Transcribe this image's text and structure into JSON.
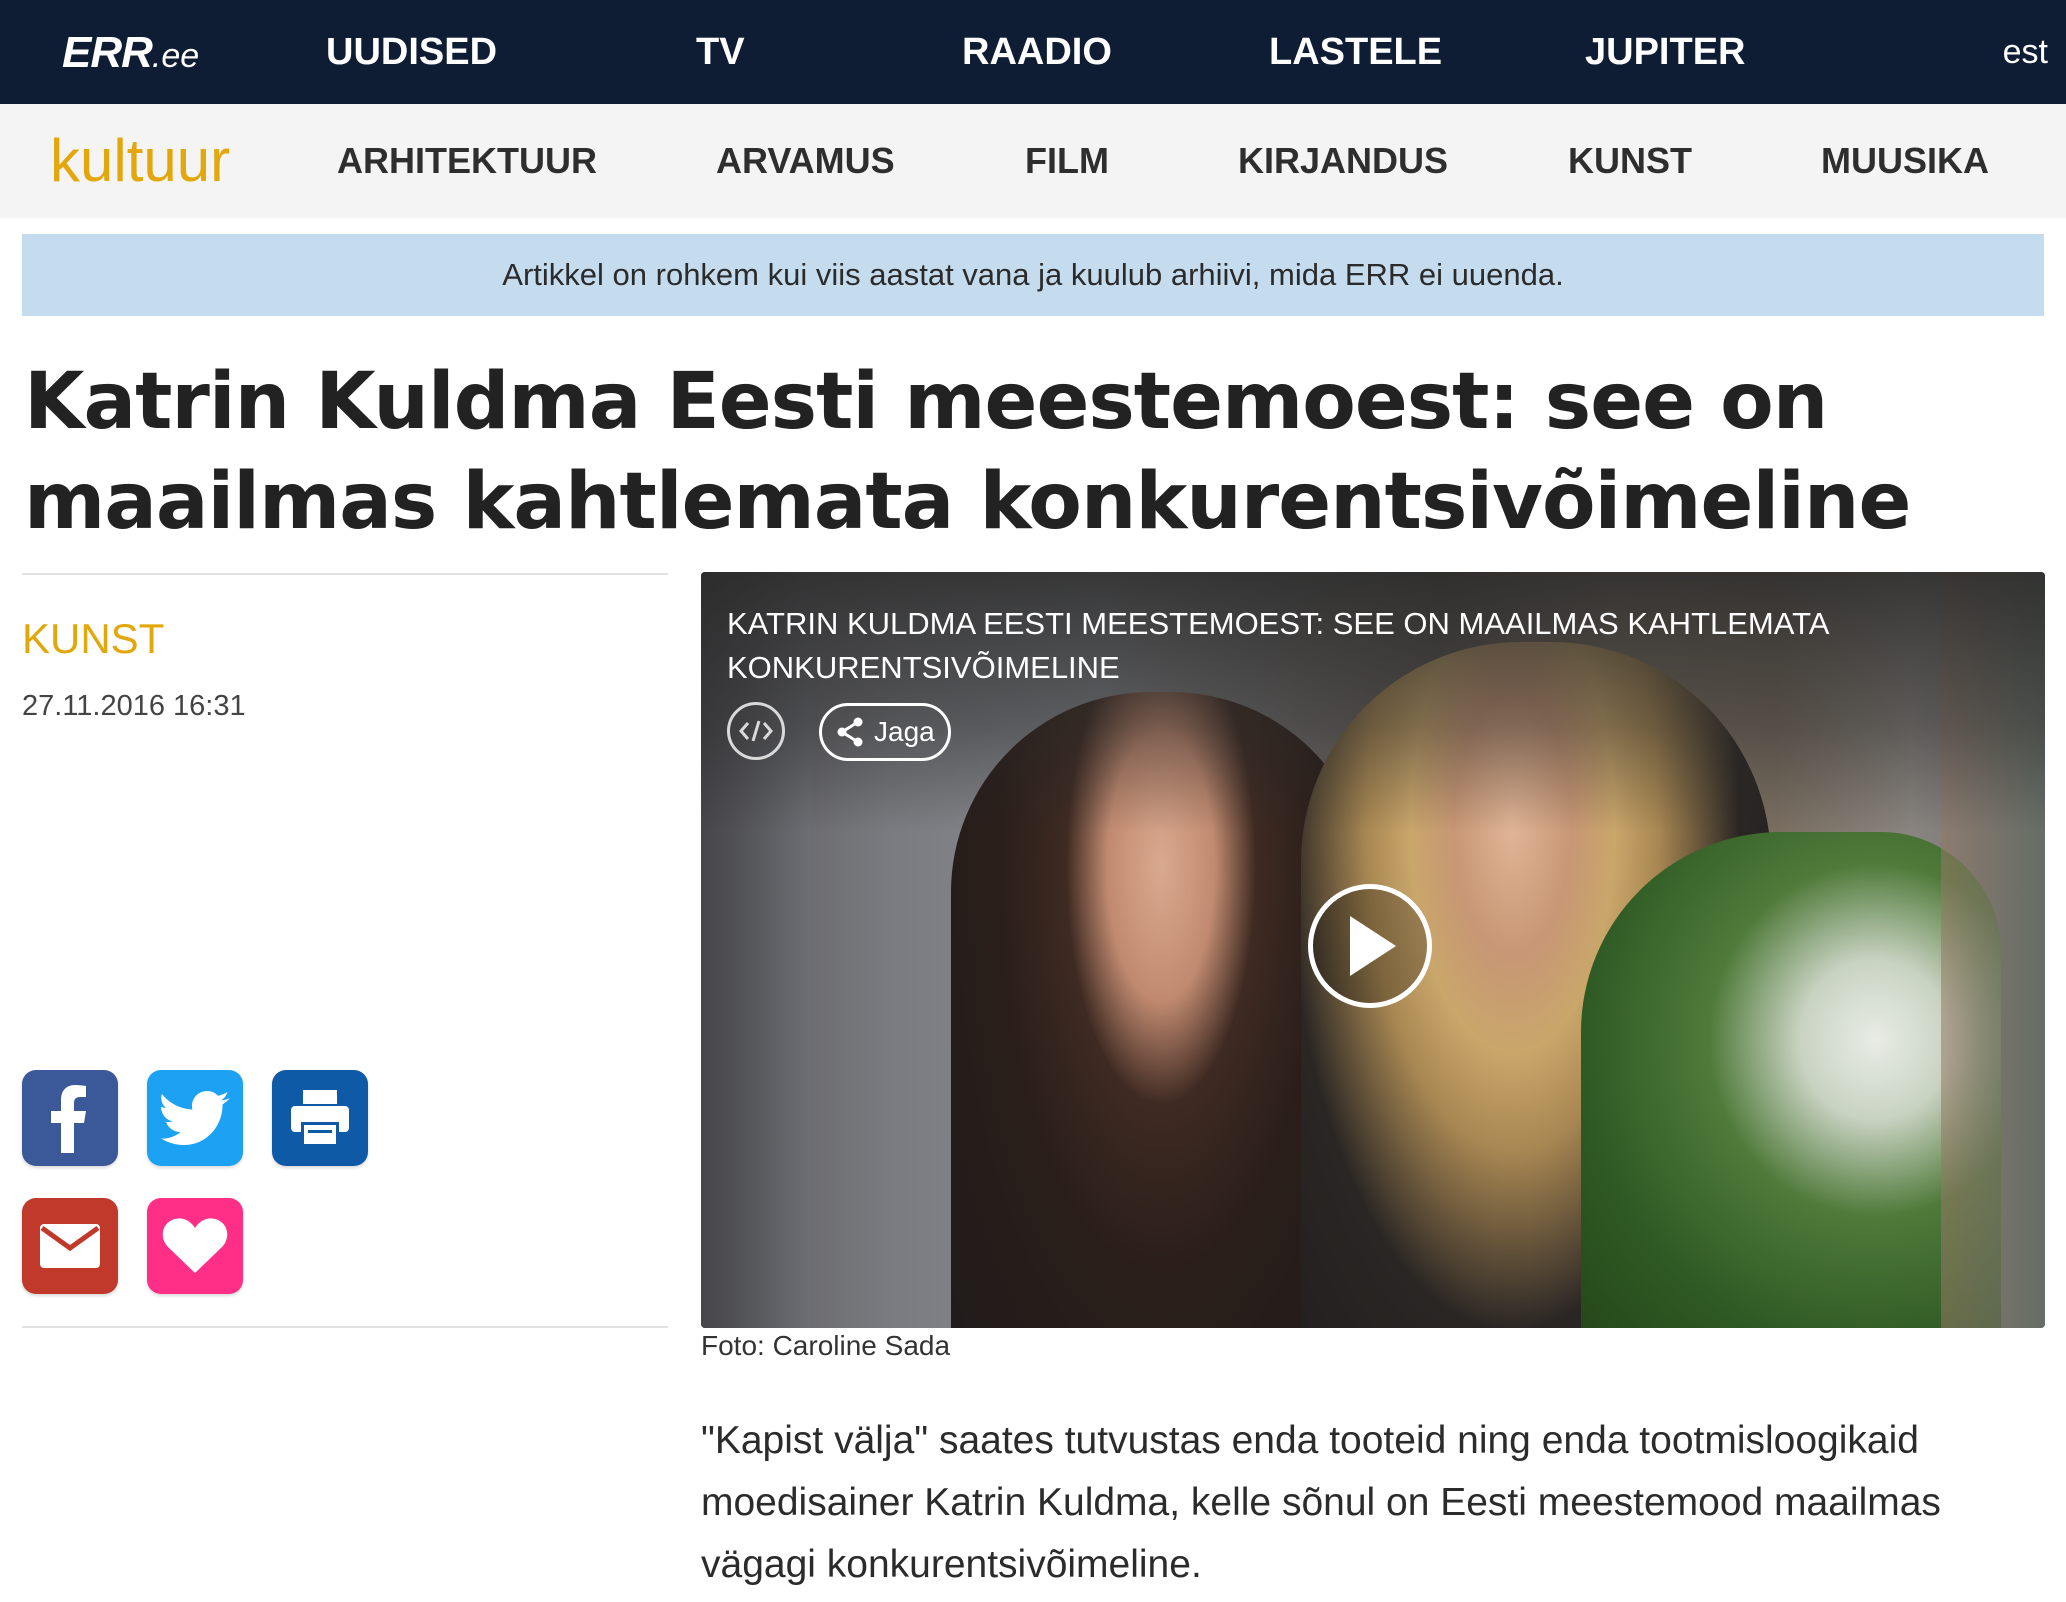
{
  "topbar": {
    "logo": "ERR",
    "logo_suffix": ".ee",
    "nav": [
      "UUDISED",
      "TV",
      "RAADIO",
      "LASTELE",
      "JUPITER"
    ],
    "language": "est",
    "background_color": "#0e1d33"
  },
  "section_bar": {
    "name": "kultuur",
    "name_color": "#e2a70a",
    "nav": [
      "ARHITEKTUUR",
      "ARVAMUS",
      "FILM",
      "KIRJANDUS",
      "KUNST",
      "MUUSIKA"
    ]
  },
  "notice": {
    "text": "Artikkel on rohkem kui viis aastat vana ja kuulub arhiivi, mida ERR ei uuenda.",
    "background_color": "#c5dcef"
  },
  "article": {
    "headline": "Katrin Kuldma Eesti meestemoest: see on maailmas kahtlemata konkurentsivõimeline",
    "category": "KUNST",
    "date": "27.11.2016 16:31",
    "share_icons": [
      "facebook-icon",
      "twitter-icon",
      "print-icon",
      "email-icon",
      "heart-icon"
    ],
    "video": {
      "title": "Katrin Kuldma Eesti meestemoest: see on maailmas kahtlemata konkurentsivõimeline",
      "share_label": "Jaga"
    },
    "photo_caption": "Foto: Caroline Sada",
    "lead": "\"Kapist välja\" saates tutvustas enda tooteid ning enda tootmisloogikaid moedisainer Katrin Kuldma, kelle sõnul on Eesti meestemood maailmas vägagi konkurentsivõimeline."
  },
  "colors": {
    "facebook": "#3b5998",
    "twitter": "#1da1f2",
    "print": "#0f5aa6",
    "email": "#c0392b",
    "heart": "#ff2e86"
  }
}
